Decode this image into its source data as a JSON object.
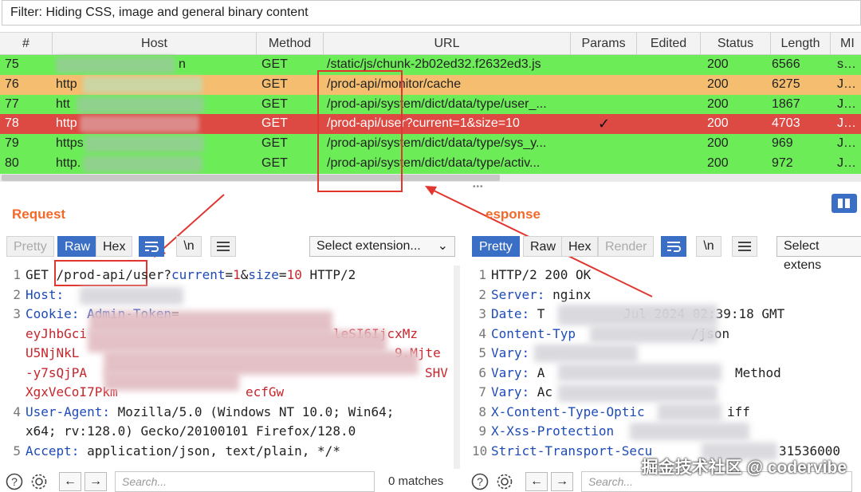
{
  "filter": "Filter: Hiding CSS, image and general binary content",
  "columns": [
    "#",
    "Host",
    "Method",
    "URL",
    "Params",
    "Edited",
    "Status",
    "Length",
    "MI"
  ],
  "rows": [
    {
      "num": "75",
      "host": "n",
      "method": "GET",
      "url": "/static/js/chunk-2b02ed32.f2632ed3.js",
      "params": "",
      "status": "200",
      "length": "6566",
      "mime": "scrip",
      "color": "green"
    },
    {
      "num": "76",
      "host": "http",
      "method": "GET",
      "url": "/prod-api/monitor/cache",
      "params": "",
      "status": "200",
      "length": "6275",
      "mime": "JSON",
      "color": "orange"
    },
    {
      "num": "77",
      "host": "htt",
      "method": "GET",
      "url": "/prod-api/system/dict/data/type/user_...",
      "params": "",
      "status": "200",
      "length": "1867",
      "mime": "JSON",
      "color": "green"
    },
    {
      "num": "78",
      "host": "http",
      "method": "GET",
      "url": "/prod-api/user?current=1&size=10",
      "params": "✓",
      "status": "200",
      "length": "4703",
      "mime": "JSON",
      "color": "red"
    },
    {
      "num": "79",
      "host": "https",
      "method": "GET",
      "url": "/prod-api/system/dict/data/type/sys_y...",
      "params": "",
      "status": "200",
      "length": "969",
      "mime": "JSON",
      "color": "green"
    },
    {
      "num": "80",
      "host": "http.",
      "method": "GET",
      "url": "/prod-api/system/dict/data/type/activ...",
      "params": "",
      "status": "200",
      "length": "972",
      "mime": "JSON",
      "color": "green"
    }
  ],
  "request": {
    "title": "Request",
    "tabs": {
      "pretty": "Pretty",
      "raw": "Raw",
      "hex": "Hex"
    },
    "newline": "\\n",
    "select_ext": "Select extension...",
    "lines": {
      "l1_num": "1",
      "l1_method": "GET ",
      "l1_path": "/prod-api/",
      "l1_path2": "user?",
      "l1_p1": "current",
      "l1_eq1": "=",
      "l1_v1": "1",
      "l1_amp": "&",
      "l1_p2": "size",
      "l1_eq2": "=",
      "l1_v2": "10",
      "l1_proto": " HTTP/2",
      "l2_num": "2",
      "l2_key": "Host:",
      "l2_val": "",
      "l3_num": "3",
      "l3_key": "Cookie: ",
      "l3_k2": "Admin-Token",
      "l3_eq": "=",
      "l3b": "eyJhbGci",
      "l3b_tail": "leSI6IjcxMz",
      "l3c": "U5NjNkL",
      "l3c_tail": "9.Mjte",
      "l3d": "-y7sQjPA",
      "l3d_tail": "SHV",
      "l3e": "XgxVeCoI7Pkm",
      "l3e_tail": "ecfGw",
      "l4_num": "4",
      "l4_key": "User-Agent: ",
      "l4_val": "Mozilla/5.0 (Windows NT 10.0; Win64;",
      "l4b": "x64; rv:128.0) Gecko/20100101 Firefox/128.0",
      "l5_num": "5",
      "l5_key": "Accept: ",
      "l5_val": "application/json, text/plain, */*"
    }
  },
  "response": {
    "title": "esponse",
    "tabs": {
      "pretty": "Pretty",
      "raw": "Raw",
      "hex": "Hex",
      "render": "Render"
    },
    "newline": "\\n",
    "select_ext": "Select extens",
    "lines": {
      "l1_num": "1",
      "l1": "HTTP/2 200 OK",
      "l2_num": "2",
      "l2_key": "Server: ",
      "l2_val": "nginx",
      "l3_num": "3",
      "l3_key": "Date: ",
      "l3_val": "T",
      "l3_tail": "Jul 2024 02:39:18 GMT",
      "l4_num": "4",
      "l4_key": "Content-Typ",
      "l4_tail": "/json",
      "l5_num": "5",
      "l5_key": "Vary:",
      "l6_num": "6",
      "l6_key": "Vary: ",
      "l6_val": "A",
      "l6_tail": "Method",
      "l7_num": "7",
      "l7_key": "Vary: ",
      "l7_val": "Ac",
      "l8_num": "8",
      "l8_key": "X-Content-Type-Optic",
      "l8_tail": "iff",
      "l9_num": "9",
      "l9_key": "X-Xss-Protection",
      "l10_num": "10",
      "l10_key": "Strict-Transport-Secu",
      "l10_tail": "31536000"
    }
  },
  "bottom": {
    "search_placeholder": "Search...",
    "matches": "0 matches"
  },
  "watermark": "掘金技术社区 @ codervibe",
  "colors": {
    "green_row": "#6ced58",
    "orange_row": "#f5bd70",
    "red_row": "#dc4a43",
    "accent": "#3b6fc5",
    "title": "#f26a2b",
    "annotation": "#e0362f"
  }
}
